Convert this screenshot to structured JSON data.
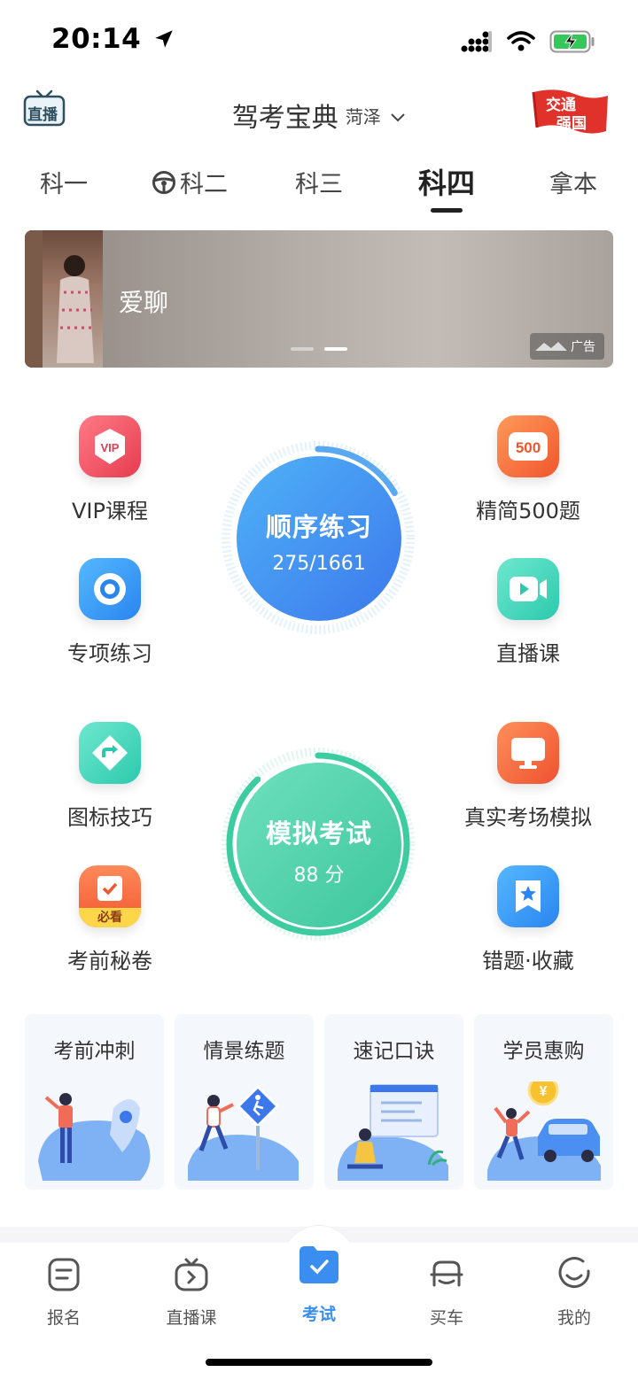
{
  "status_bar": {
    "time": "20:14"
  },
  "header": {
    "live_badge": "直播",
    "title": "驾考宝典",
    "city": "菏泽",
    "flag_text": [
      "交通",
      "强国"
    ]
  },
  "tabs": [
    {
      "label": "科一",
      "active": false
    },
    {
      "label": "科二",
      "active": false,
      "icon": "steering-wheel-icon"
    },
    {
      "label": "科三",
      "active": false
    },
    {
      "label": "科四",
      "active": true
    },
    {
      "label": "拿本",
      "active": false
    }
  ],
  "banner": {
    "text": "爱聊",
    "ad_label": "广告",
    "slide_count": 2,
    "active_slide": 2
  },
  "practice": {
    "sequential": {
      "title": "顺序练习",
      "progress": "275/1661",
      "done": 275,
      "total": 1661
    },
    "mock_exam": {
      "title": "模拟考试",
      "score": "88 分",
      "score_value": 88,
      "max_score": 100
    }
  },
  "features": {
    "vip": {
      "label": "VIP课程",
      "icon": "vip-badge-icon",
      "color": "#ef4b5a"
    },
    "q500": {
      "label": "精简500题",
      "icon": "500-badge-icon",
      "color": "#f46a3a"
    },
    "special": {
      "label": "专项练习",
      "icon": "target-icon",
      "color": "#2f9cf2"
    },
    "live": {
      "label": "直播课",
      "icon": "video-camera-icon",
      "color": "#2fd0b7"
    },
    "signs": {
      "label": "图标技巧",
      "icon": "turn-sign-icon",
      "color": "#2fd0b7"
    },
    "real_exam": {
      "label": "真实考场模拟",
      "icon": "monitor-icon",
      "color": "#f46a3a"
    },
    "secret": {
      "label": "考前秘卷",
      "icon": "checklist-icon",
      "badge": "必看",
      "color": "#f46a3a"
    },
    "mistakes": {
      "label": "错题·收藏",
      "icon": "bookmark-star-icon",
      "color": "#2f9cf2"
    }
  },
  "cards": [
    {
      "label": "考前冲刺",
      "illustration": "rocket-illustration"
    },
    {
      "label": "情景练题",
      "illustration": "pedestrian-sign-illustration"
    },
    {
      "label": "速记口诀",
      "illustration": "board-illustration"
    },
    {
      "label": "学员惠购",
      "illustration": "car-coin-illustration"
    }
  ],
  "bottom_nav": [
    {
      "label": "报名",
      "icon": "form-icon",
      "active": false
    },
    {
      "label": "直播课",
      "icon": "tv-play-icon",
      "active": false
    },
    {
      "label": "考试",
      "icon": "folder-check-icon",
      "active": true
    },
    {
      "label": "买车",
      "icon": "car-front-icon",
      "active": false
    },
    {
      "label": "我的",
      "icon": "smile-face-icon",
      "active": false
    }
  ],
  "colors": {
    "accent_blue": "#3a8ef0",
    "green": "#3dcca0",
    "text_dark": "#222222"
  }
}
